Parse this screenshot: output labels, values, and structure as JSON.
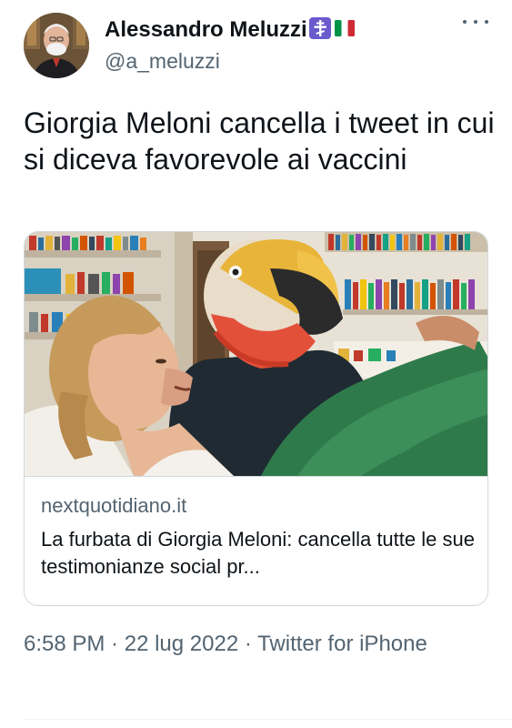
{
  "author": {
    "display_name": "Alessandro Meluzzi",
    "handle": "@a_meluzzi"
  },
  "tweet": {
    "text": "Giorgia Meloni cancella i tweet in cui si diceva favorevole ai vaccini"
  },
  "card": {
    "domain": "nextquotidiano.it",
    "title": "La furbata di Giorgia Meloni: cancella tutte le sue testimonianze social pr..."
  },
  "meta": {
    "time": "6:58 PM",
    "separator": " · ",
    "date": "22 lug 2022",
    "source": "Twitter for iPhone"
  },
  "icons": {
    "badge": "orthodox-cross-icon",
    "flag": "italy-flag-icon",
    "more": "more-icon"
  },
  "colors": {
    "text_primary": "#0f1419",
    "text_secondary": "#536471",
    "border": "#cfd9de",
    "badge_purple": "#6a5acd",
    "flag_green": "#009246",
    "flag_white": "#ffffff",
    "flag_red": "#ce2b37"
  }
}
